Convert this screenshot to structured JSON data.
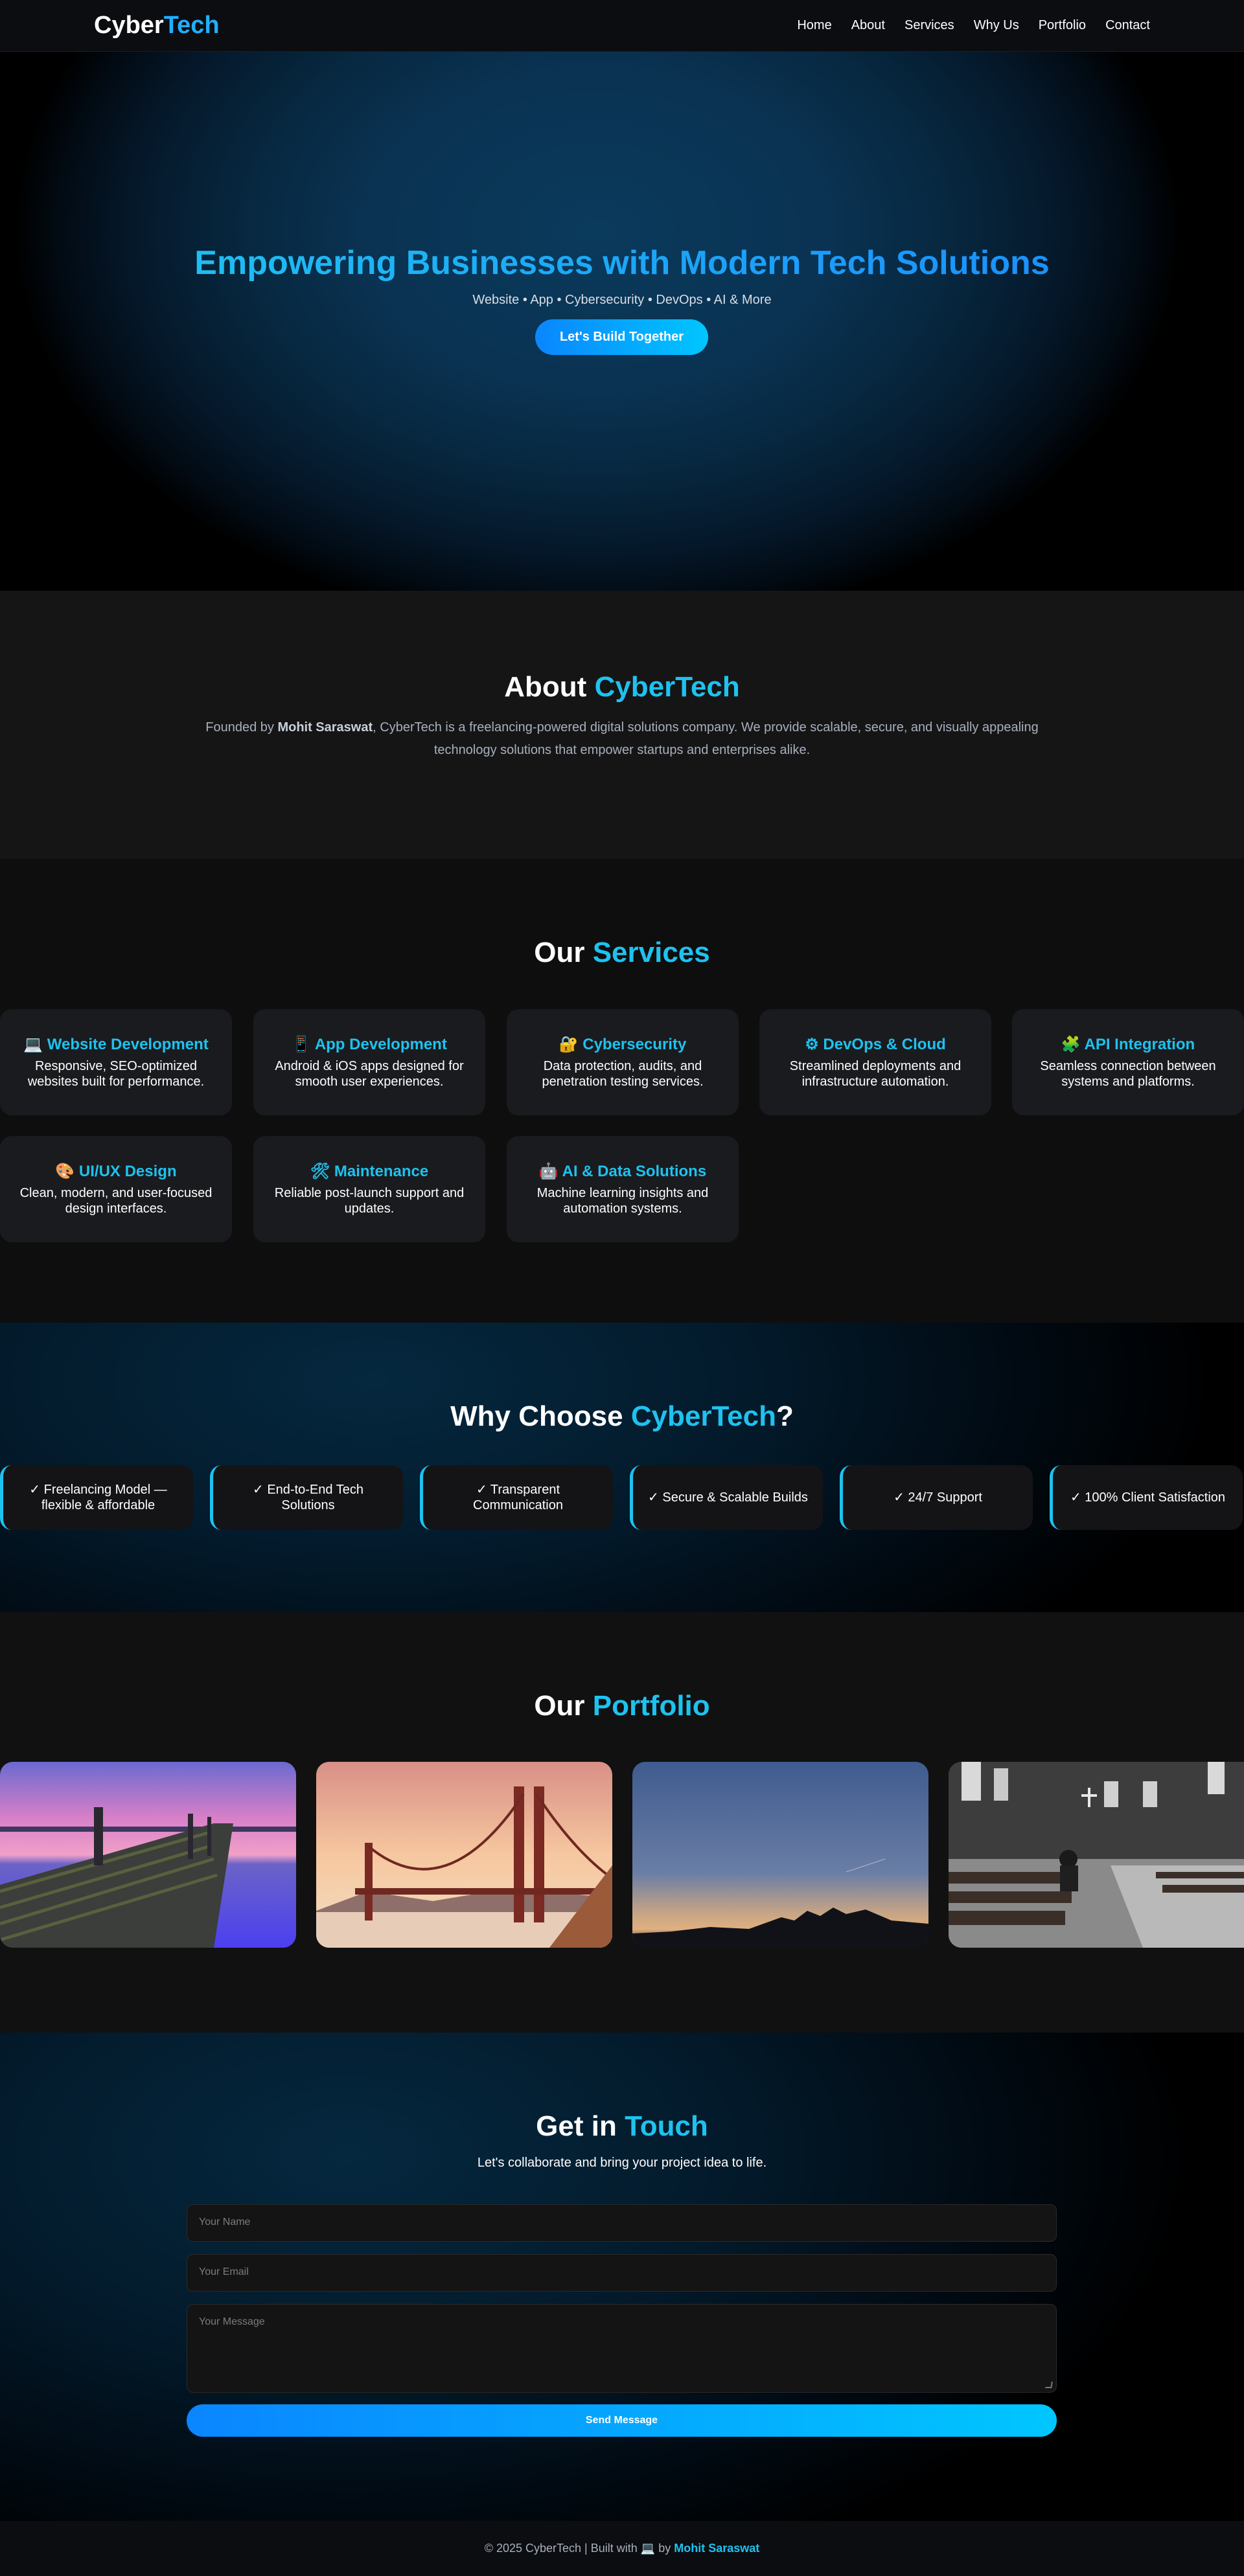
{
  "nav": {
    "logo_part1": "Cyber",
    "logo_part2": "Tech",
    "links": [
      "Home",
      "About",
      "Services",
      "Why Us",
      "Portfolio",
      "Contact"
    ]
  },
  "hero": {
    "title": "Empowering Businesses with Modern Tech Solutions",
    "subtitle": "Website • App • Cybersecurity • DevOps • AI & More",
    "cta_label": "Let's Build Together"
  },
  "about": {
    "title_part1": "About",
    "title_part2": "CyberTech",
    "text_prefix": "Founded by ",
    "founder": "Mohit Saraswat",
    "text_suffix": ", CyberTech is a freelancing-powered digital solutions company. We provide scalable, secure, and visually appealing technology solutions that empower startups and enterprises alike."
  },
  "services": {
    "title_part1": "Our",
    "title_part2": "Services",
    "items": [
      {
        "icon": "laptop-icon",
        "glyph": "💻",
        "title": "Website Development",
        "desc": "Responsive, SEO-optimized websites built for performance."
      },
      {
        "icon": "phone-icon",
        "glyph": "📱",
        "title": "App Development",
        "desc": "Android & iOS apps designed for smooth user experiences."
      },
      {
        "icon": "lock-icon",
        "glyph": "🔐",
        "title": "Cybersecurity",
        "desc": "Data protection, audits, and penetration testing services."
      },
      {
        "icon": "gear-icon",
        "glyph": "⚙",
        "title": "DevOps & Cloud",
        "desc": "Streamlined deployments and infrastructure automation."
      },
      {
        "icon": "puzzle-icon",
        "glyph": "🧩",
        "title": "API Integration",
        "desc": "Seamless connection between systems and platforms."
      },
      {
        "icon": "palette-icon",
        "glyph": "🎨",
        "title": "UI/UX Design",
        "desc": "Clean, modern, and user-focused design interfaces."
      },
      {
        "icon": "tools-icon",
        "glyph": "🛠",
        "title": "Maintenance",
        "desc": "Reliable post-launch support and updates."
      },
      {
        "icon": "robot-icon",
        "glyph": "🤖",
        "title": "AI & Data Solutions",
        "desc": "Machine learning insights and automation systems."
      }
    ]
  },
  "why": {
    "title_part1": "Why Choose",
    "title_part2": "CyberTech",
    "title_part3": "?",
    "items": [
      "✓ Freelancing Model — flexible & affordable",
      "✓ End-to-End Tech Solutions",
      "✓ Transparent Communication",
      "✓ Secure & Scalable Builds",
      "✓ 24/7 Support",
      "✓ 100% Client Satisfaction"
    ]
  },
  "portfolio": {
    "title_part1": "Our",
    "title_part2": "Portfolio",
    "images": [
      "pier-sunset-image",
      "golden-gate-bridge-image",
      "city-skyline-dusk-image",
      "church-interior-image"
    ]
  },
  "contact": {
    "title_part1": "Get in",
    "title_part2": "Touch",
    "lead": "Let's collaborate and bring your project idea to life.",
    "name_placeholder": "Your Name",
    "email_placeholder": "Your Email",
    "message_placeholder": "Your Message",
    "send_label": "Send Message"
  },
  "footer": {
    "text": "© 2025 CyberTech | Built with",
    "glyph": "💻",
    "by": "by",
    "name": "Mohit Saraswat"
  },
  "colors": {
    "accent": "#1ec2ef",
    "gradient_start": "#0a86ff",
    "gradient_end": "#00c6ff",
    "background": "#111112"
  }
}
